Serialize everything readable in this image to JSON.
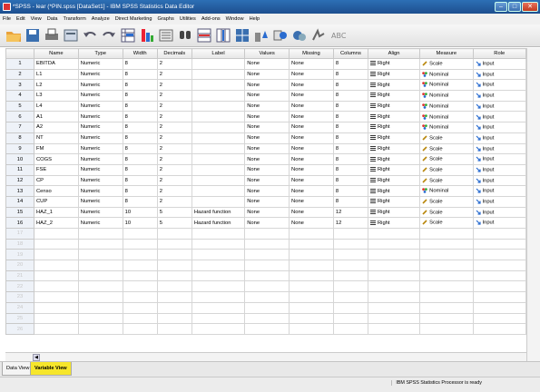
{
  "window": {
    "title": "*SPSS - lear (*PIN.spss [DataSet1] - IBM SPSS Statistics Data Editor"
  },
  "menu": [
    "File",
    "Edit",
    "View",
    "Data",
    "Transform",
    "Analyze",
    "Direct Marketing",
    "Graphs",
    "Utilities",
    "Add-ons",
    "Window",
    "Help"
  ],
  "toolbar_icons": [
    "open-folder-icon",
    "save-icon",
    "print-icon",
    "dialog-recall-icon",
    "undo-icon",
    "redo-icon",
    "goto-case-icon",
    "goto-variable-icon",
    "variables-icon",
    "find-icon",
    "insert-cases-icon",
    "insert-variable-icon",
    "split-file-icon",
    "weight-cases-icon",
    "select-cases-icon",
    "value-labels-icon",
    "use-sets-icon",
    "spelling-icon"
  ],
  "columns": [
    "Name",
    "Type",
    "Width",
    "Decimals",
    "Label",
    "Values",
    "Missing",
    "Columns",
    "Align",
    "Measure",
    "Role"
  ],
  "rows": [
    {
      "n": "1",
      "name": "EBITDA",
      "type": "Numeric",
      "width": "8",
      "decimals": "2",
      "label": "",
      "values": "None",
      "missing": "None",
      "columns": "8",
      "align": "Right",
      "measure": "Scale",
      "role": "Input"
    },
    {
      "n": "2",
      "name": "L1",
      "type": "Numeric",
      "width": "8",
      "decimals": "2",
      "label": "",
      "values": "None",
      "missing": "None",
      "columns": "8",
      "align": "Right",
      "measure": "Nominal",
      "role": "Input"
    },
    {
      "n": "3",
      "name": "L2",
      "type": "Numeric",
      "width": "8",
      "decimals": "2",
      "label": "",
      "values": "None",
      "missing": "None",
      "columns": "8",
      "align": "Right",
      "measure": "Nominal",
      "role": "Input"
    },
    {
      "n": "4",
      "name": "L3",
      "type": "Numeric",
      "width": "8",
      "decimals": "2",
      "label": "",
      "values": "None",
      "missing": "None",
      "columns": "8",
      "align": "Right",
      "measure": "Nominal",
      "role": "Input"
    },
    {
      "n": "5",
      "name": "L4",
      "type": "Numeric",
      "width": "8",
      "decimals": "2",
      "label": "",
      "values": "None",
      "missing": "None",
      "columns": "8",
      "align": "Right",
      "measure": "Nominal",
      "role": "Input"
    },
    {
      "n": "6",
      "name": "A1",
      "type": "Numeric",
      "width": "8",
      "decimals": "2",
      "label": "",
      "values": "None",
      "missing": "None",
      "columns": "8",
      "align": "Right",
      "measure": "Nominal",
      "role": "Input"
    },
    {
      "n": "7",
      "name": "A2",
      "type": "Numeric",
      "width": "8",
      "decimals": "2",
      "label": "",
      "values": "None",
      "missing": "None",
      "columns": "8",
      "align": "Right",
      "measure": "Nominal",
      "role": "Input"
    },
    {
      "n": "8",
      "name": "NT",
      "type": "Numeric",
      "width": "8",
      "decimals": "2",
      "label": "",
      "values": "None",
      "missing": "None",
      "columns": "8",
      "align": "Right",
      "measure": "Scale",
      "role": "Input"
    },
    {
      "n": "9",
      "name": "FM",
      "type": "Numeric",
      "width": "8",
      "decimals": "2",
      "label": "",
      "values": "None",
      "missing": "None",
      "columns": "8",
      "align": "Right",
      "measure": "Scale",
      "role": "Input"
    },
    {
      "n": "10",
      "name": "COGS",
      "type": "Numeric",
      "width": "8",
      "decimals": "2",
      "label": "",
      "values": "None",
      "missing": "None",
      "columns": "8",
      "align": "Right",
      "measure": "Scale",
      "role": "Input"
    },
    {
      "n": "11",
      "name": "FSE",
      "type": "Numeric",
      "width": "8",
      "decimals": "2",
      "label": "",
      "values": "None",
      "missing": "None",
      "columns": "8",
      "align": "Right",
      "measure": "Scale",
      "role": "Input"
    },
    {
      "n": "12",
      "name": "CP",
      "type": "Numeric",
      "width": "8",
      "decimals": "2",
      "label": "",
      "values": "None",
      "missing": "None",
      "columns": "8",
      "align": "Right",
      "measure": "Scale",
      "role": "Input"
    },
    {
      "n": "13",
      "name": "Censo",
      "type": "Numeric",
      "width": "8",
      "decimals": "2",
      "label": "",
      "values": "None",
      "missing": "None",
      "columns": "8",
      "align": "Right",
      "measure": "Nominal",
      "role": "Input"
    },
    {
      "n": "14",
      "name": "CUP",
      "type": "Numeric",
      "width": "8",
      "decimals": "2",
      "label": "",
      "values": "None",
      "missing": "None",
      "columns": "8",
      "align": "Right",
      "measure": "Scale",
      "role": "Input"
    },
    {
      "n": "15",
      "name": "HAZ_1",
      "type": "Numeric",
      "width": "10",
      "decimals": "5",
      "label": "Hazard function",
      "values": "None",
      "missing": "None",
      "columns": "12",
      "align": "Right",
      "measure": "Scale",
      "role": "Input"
    },
    {
      "n": "16",
      "name": "HAZ_2",
      "type": "Numeric",
      "width": "10",
      "decimals": "5",
      "label": "Hazard function",
      "values": "None",
      "missing": "None",
      "columns": "12",
      "align": "Right",
      "measure": "Scale",
      "role": "Input"
    }
  ],
  "empty_rows": [
    "17",
    "18",
    "19",
    "20",
    "21",
    "22",
    "23",
    "24",
    "25",
    "26"
  ],
  "tabs": {
    "data_view": "Data View",
    "variable_view": "Variable View"
  },
  "status": "IBM SPSS Statistics Processor is ready",
  "colors": {
    "active_tab": "#f6e62b",
    "title_bar": "#2d6fb5"
  }
}
